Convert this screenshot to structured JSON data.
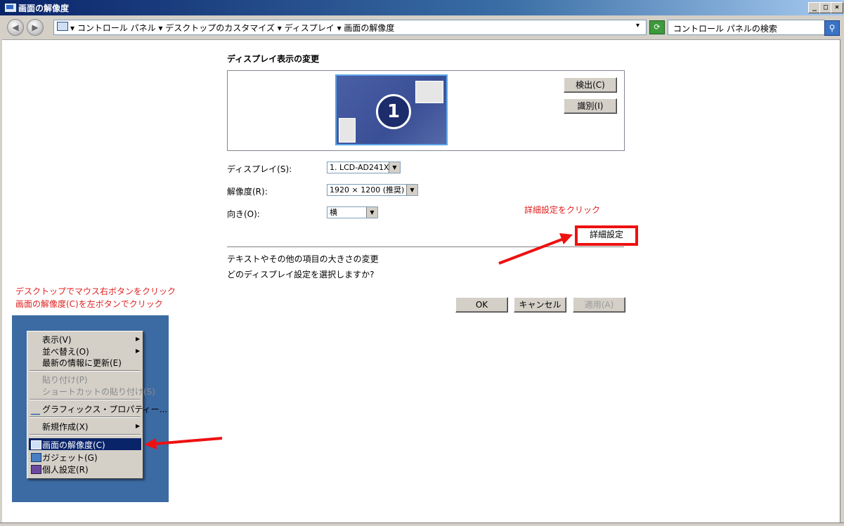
{
  "window": {
    "title": "画面の解像度",
    "buttons": {
      "minimize": "_",
      "maximize": "□",
      "close": "×"
    }
  },
  "address_bar": {
    "breadcrumb": "▾ コントロール パネル ▾ デスクトップのカスタマイズ ▾ ディスプレイ ▾ 画面の解像度",
    "dropdown": "▾",
    "search_placeholder": "コントロール パネルの検索"
  },
  "main": {
    "section_title": "ディスプレイ表示の変更",
    "monitor_number": "1",
    "detect_button": "検出(C)",
    "identify_button": "識別(I)",
    "fields": {
      "display_label": "ディスプレイ(S):",
      "display_value": "1. LCD-AD241X",
      "resolution_label": "解像度(R):",
      "resolution_value": "1920 × 1200 (推奨)",
      "orientation_label": "向き(O):",
      "orientation_value": "横"
    },
    "advanced_button": "詳細設定",
    "link_text_size": "テキストやその他の項目の大きさの変更",
    "link_which": "どのディスプレイ設定を選択しますか?",
    "ok_button": "OK",
    "cancel_button": "キャンセル",
    "apply_button": "適用(A)"
  },
  "annotations": {
    "click_advanced": "詳細設定をクリック",
    "instruction_1": "デスクトップでマウス右ボタンをクリック",
    "instruction_2": "画面の解像度(C)を左ボタンでクリック",
    "arrow_color": "#ee1111"
  },
  "context_menu": {
    "items": [
      {
        "label": "表示(V)",
        "submenu": true
      },
      {
        "label": "並べ替え(O)",
        "submenu": true
      },
      {
        "label": "最新の情報に更新(E)"
      },
      {
        "label": "貼り付け(P)",
        "disabled": true
      },
      {
        "label": "ショートカットの貼り付け(S)",
        "disabled": true
      },
      {
        "label": "グラフィックス・プロパティー..."
      },
      {
        "label": "新規作成(X)",
        "submenu": true
      },
      {
        "label": "画面の解像度(C)",
        "highlighted": true
      },
      {
        "label": "ガジェット(G)"
      },
      {
        "label": "個人設定(R)"
      }
    ],
    "submenu_arrow": "▶"
  },
  "colors": {
    "titlebar": "#0a246a",
    "desktop": "#3c6ba3",
    "annotation_red": "#e02020"
  }
}
